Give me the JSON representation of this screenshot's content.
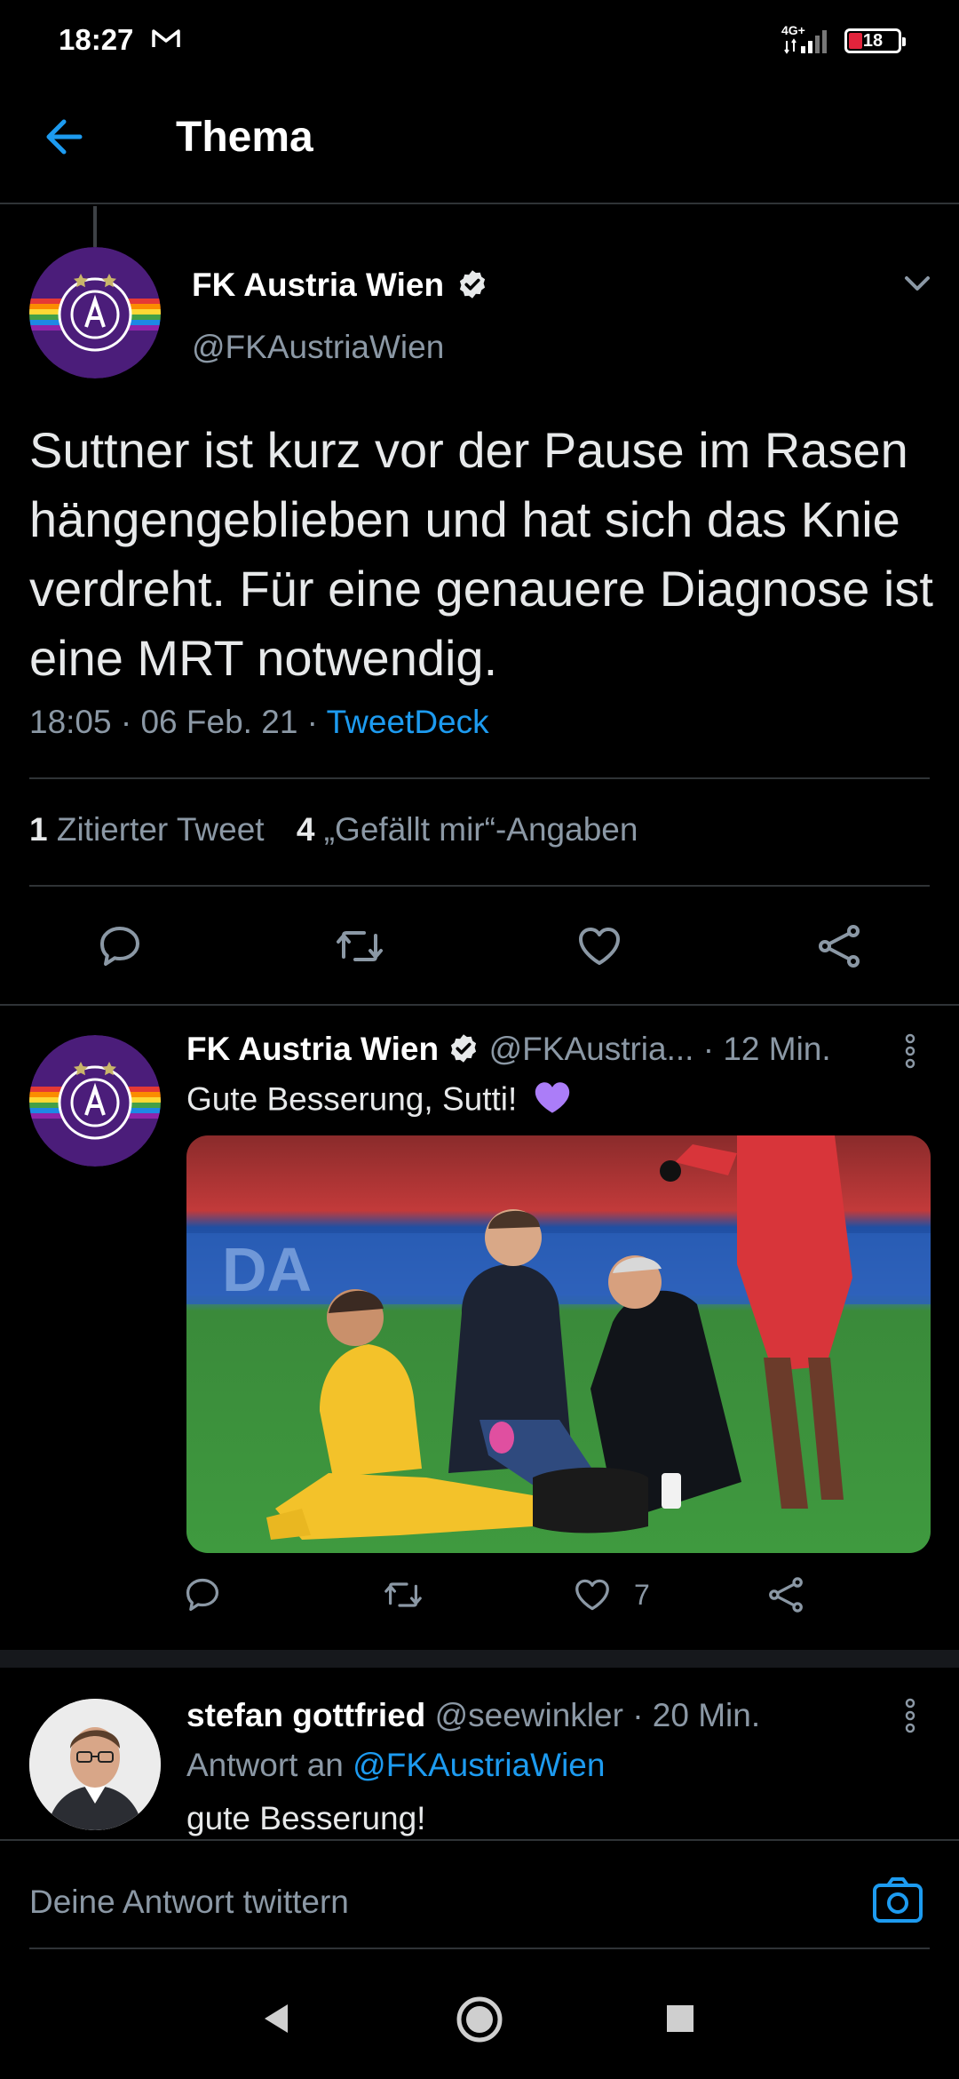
{
  "status_bar": {
    "time": "18:27",
    "network": "4G+",
    "battery": "18",
    "icons": [
      "gmail-icon",
      "signal-icon",
      "battery-icon"
    ]
  },
  "header": {
    "title": "Thema",
    "back_icon": "arrow-left-icon"
  },
  "main_tweet": {
    "author_name": "FK Austria Wien",
    "author_handle": "@FKAustriaWien",
    "avatar_text": "FUSSBALLKLUB · AUSTRIA WIEN · FAK",
    "text": "Suttner ist kurz vor der Pause im Rasen hängengeblieben und hat sich das Knie verdreht. Für eine genauere Diagnose ist eine MRT notwendig.",
    "time": "18:05",
    "separator": "·",
    "date": "06 Feb. 21",
    "source": "TweetDeck",
    "quote_count": "1",
    "quote_label": "Zitierter Tweet",
    "like_count": "4",
    "like_label": "„Gefällt mir“-Angaben"
  },
  "quote_tweet": {
    "author_name": "FK Austria Wien",
    "author_handle": "@FKAustria...",
    "time": "· 12 Min.",
    "text": "Gute Besserung, Sutti!",
    "emoji": "💜",
    "like_count": "7"
  },
  "reply_tweet": {
    "author_name": "stefan gottfried",
    "author_handle": "@seewinkler",
    "time": "· 20 Min.",
    "reply_prefix": "Antwort an",
    "reply_to": "@FKAustriaWien",
    "text": "gute Besserung!"
  },
  "composer": {
    "placeholder": "Deine Antwort twittern"
  },
  "colors": {
    "background": "#000000",
    "accent": "#1d9bf0",
    "muted": "#8b98a5",
    "divider": "#2f3336",
    "austria_purple": "#4b1d7a"
  }
}
